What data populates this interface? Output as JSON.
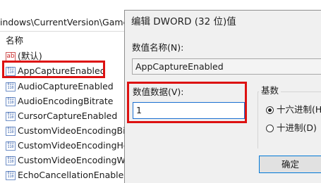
{
  "registry": {
    "path": "indows\\CurrentVersion\\GameD",
    "column_header": "名称",
    "values": [
      {
        "name": "(默认)",
        "icon": "string-value-icon"
      },
      {
        "name": "AppCaptureEnabled",
        "icon": "dword-value-icon"
      },
      {
        "name": "AudioCaptureEnabled",
        "icon": "dword-value-icon"
      },
      {
        "name": "AudioEncodingBitrate",
        "icon": "dword-value-icon"
      },
      {
        "name": "CursorCaptureEnabled",
        "icon": "dword-value-icon"
      },
      {
        "name": "CustomVideoEncodingBitra",
        "icon": "dword-value-icon"
      },
      {
        "name": "CustomVideoEncodingHei",
        "icon": "dword-value-icon"
      },
      {
        "name": "CustomVideoEncodingWid",
        "icon": "dword-value-icon"
      },
      {
        "name": "EchoCancellationEnabled",
        "icon": "dword-value-icon"
      }
    ],
    "icon_text": {
      "string": "ab",
      "binary_top": "011",
      "binary_bottom": "110"
    }
  },
  "dialog": {
    "title": "编辑 DWORD (32 位)值",
    "value_name_label": "数值名称(N):",
    "value_name": "AppCaptureEnabled",
    "value_data_label": "数值数据(V):",
    "value_data": "1",
    "base_label": "基数",
    "base_options": [
      {
        "label": "十六进制(H)",
        "selected": true
      },
      {
        "label": "十进制(D)",
        "selected": false
      }
    ],
    "ok_label": "确定"
  },
  "colors": {
    "highlight": "#dd1111",
    "focus": "#1a6fd1"
  }
}
